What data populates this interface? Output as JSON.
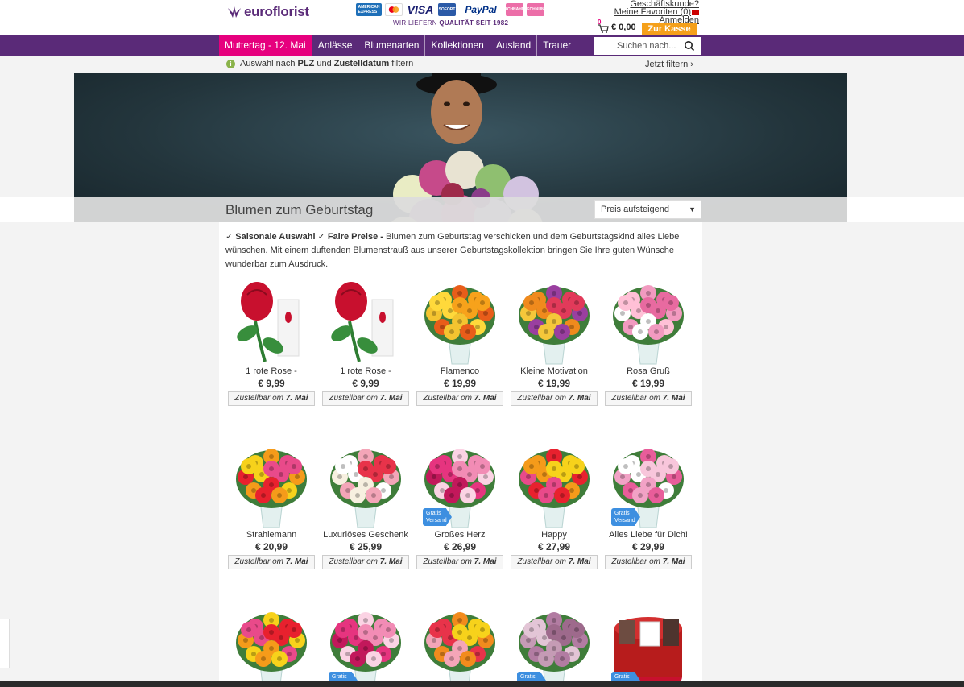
{
  "header": {
    "logo_text": "euroflorist",
    "tagline_prefix": "WIR LIEFERN ",
    "tagline_bold": "QUALITÄT SEIT 1982",
    "payments": [
      "AMERICAN EXPRESS",
      "MC",
      "VISA",
      "SOFORT",
      "PayPal",
      "NACHNAHME",
      "RECHNUNG"
    ],
    "account": {
      "business": "Geschäftskunde?",
      "favorites": "Meine Favoriten (0)",
      "login": "Anmelden"
    },
    "cart_count": "0",
    "cart_total": "€ 0,00",
    "checkout_label": "Zur Kasse"
  },
  "nav": {
    "items": [
      "Muttertag - 12. Mai",
      "Anlässe",
      "Blumenarten",
      "Kollektionen",
      "Ausland",
      "Trauer"
    ],
    "search_placeholder": "Suchen nach..."
  },
  "filter": {
    "prefix": "Auswahl nach ",
    "plz": "PLZ",
    "mid": " und ",
    "date": "Zustelldatum",
    "suffix": " filtern",
    "link": "Jetzt filtern ›"
  },
  "page": {
    "title": "Blumen zum Geburtstag",
    "sort_value": "Preis aufsteigend",
    "intro_bold1": "✓ Saisonale Auswahl ✓ Faire Preise -",
    "intro_text": " Blumen zum Geburtstag verschicken und dem Geburtstagskind alles Liebe wünschen. Mit einem duftenden Blumenstrauß aus unserer Geburtstagskollektion bringen Sie Ihre guten Wünsche wunderbar zum Ausdruck."
  },
  "delivery": {
    "prefix": "Zustellbar om ",
    "date": "7. Mai"
  },
  "badge": {
    "line1": "Gratis",
    "line2": "Versand"
  },
  "products": [
    {
      "name": "1 rote Rose -",
      "price": "€ 9,99",
      "kind": "rose",
      "badge": false
    },
    {
      "name": "1 rote Rose -",
      "price": "€ 9,99",
      "kind": "rose",
      "badge": false
    },
    {
      "name": "Flamenco",
      "price": "€ 19,99",
      "kind": "orange",
      "badge": false
    },
    {
      "name": "Kleine Motivation",
      "price": "€ 19,99",
      "kind": "mixed",
      "badge": false
    },
    {
      "name": "Rosa Gruß",
      "price": "€ 19,99",
      "kind": "pink",
      "badge": false
    },
    {
      "name": "Strahlemann",
      "price": "€ 20,99",
      "kind": "gerbera",
      "badge": false
    },
    {
      "name": "Luxuriöses Geschenk",
      "price": "€ 25,99",
      "kind": "luxury",
      "badge": false
    },
    {
      "name": "Großes Herz",
      "price": "€ 26,99",
      "kind": "pinkroses",
      "badge": true
    },
    {
      "name": "Happy",
      "price": "€ 27,99",
      "kind": "happy",
      "badge": false
    },
    {
      "name": "Alles Liebe für Dich!",
      "price": "€ 29,99",
      "kind": "lightpink",
      "badge": true
    },
    {
      "name": "",
      "price": "",
      "kind": "gerbera",
      "badge": false
    },
    {
      "name": "",
      "price": "",
      "kind": "pinkroses",
      "badge": true
    },
    {
      "name": "",
      "price": "",
      "kind": "lilies",
      "badge": false
    },
    {
      "name": "",
      "price": "",
      "kind": "lavender",
      "badge": true
    },
    {
      "name": "",
      "price": "",
      "kind": "gift",
      "badge": true
    }
  ]
}
